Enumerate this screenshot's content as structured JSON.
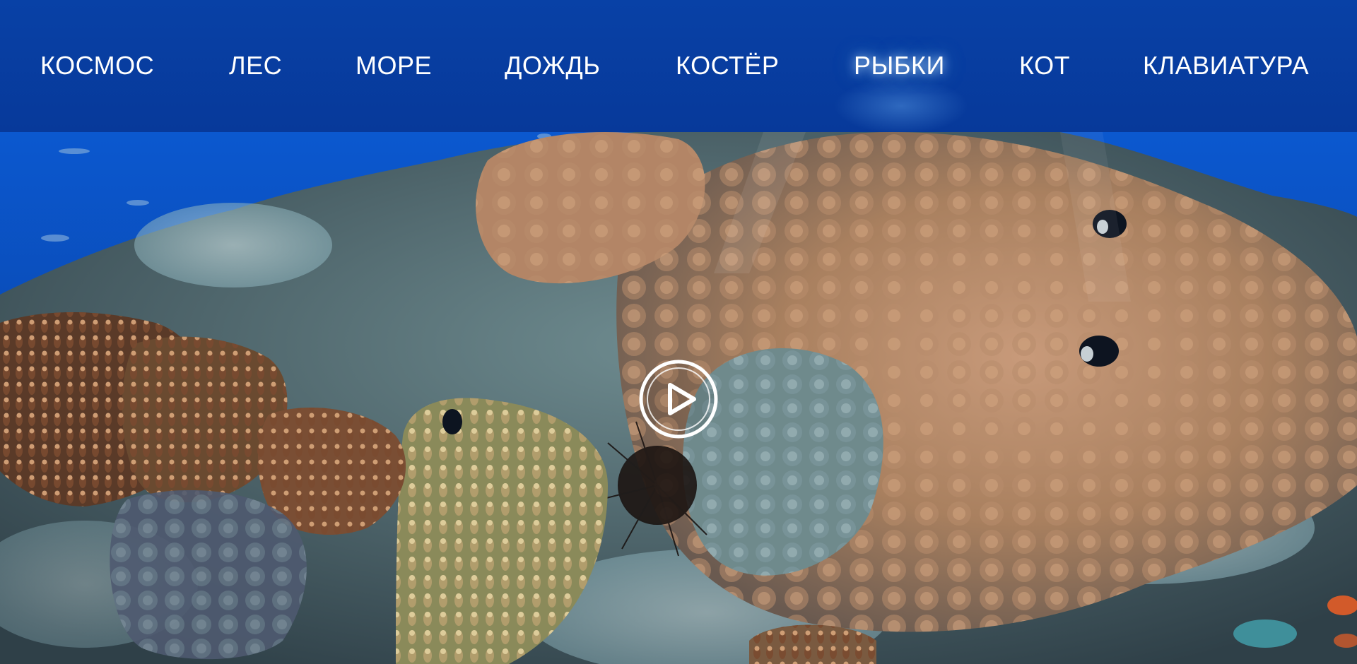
{
  "nav": {
    "items": [
      {
        "label": "КОСМОС"
      },
      {
        "label": "ЛЕС"
      },
      {
        "label": "МОРЕ"
      },
      {
        "label": "ДОЖДЬ"
      },
      {
        "label": "КОСТЁР"
      },
      {
        "label": "РЫБКИ"
      },
      {
        "label": "КОТ"
      },
      {
        "label": "КЛАВИАТУРА"
      }
    ],
    "active": "РЫБКИ"
  },
  "player": {
    "play_icon": "play-icon"
  },
  "colors": {
    "nav_background": "#0841a6",
    "nav_text": "#ffffff",
    "water": "#0a55c8",
    "coral_tan": "#b98d6e",
    "coral_dark": "#3a2e2a"
  }
}
